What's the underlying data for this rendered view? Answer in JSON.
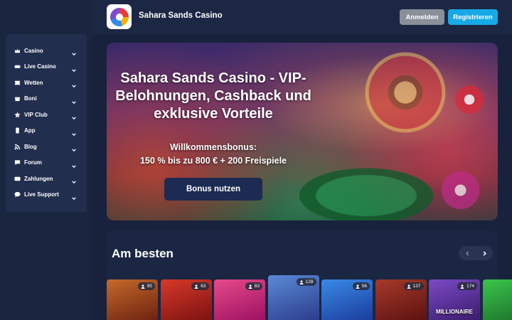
{
  "header": {
    "site_title": "Sahara Sands Casino",
    "login_label": "Anmelden",
    "register_label": "Registrieren"
  },
  "sidebar": {
    "items": [
      {
        "label": "Casino",
        "icon": "crown-icon"
      },
      {
        "label": "Live Casino",
        "icon": "gamepad-icon"
      },
      {
        "label": "Wetten",
        "icon": "ticket-icon"
      },
      {
        "label": "Boni",
        "icon": "gift-icon"
      },
      {
        "label": "VIP Club",
        "icon": "star-icon"
      },
      {
        "label": "App",
        "icon": "smartphone-icon"
      },
      {
        "label": "Blog",
        "icon": "rss-icon"
      },
      {
        "label": "Forum",
        "icon": "chat-icon"
      },
      {
        "label": "Zahlungen",
        "icon": "credit-card-icon"
      },
      {
        "label": "Live Support",
        "icon": "support-chat-icon"
      }
    ]
  },
  "hero": {
    "title": "Sahara Sands Casino - VIP-Belohnungen, Cashback und exklusive Vorteile",
    "bonus_line1": "Willkommensbonus:",
    "bonus_line2": "150 % bis zu 800 € + 200 Freispiele",
    "cta_label": "Bonus nutzen"
  },
  "best_section": {
    "title": "Am besten",
    "games": [
      {
        "players": "95",
        "name": "",
        "colors": [
          "#6a2010",
          "#c46a2a"
        ]
      },
      {
        "players": "63",
        "name": "",
        "colors": [
          "#7a1010",
          "#d63a2a"
        ]
      },
      {
        "players": "83",
        "name": "",
        "colors": [
          "#9a1060",
          "#e64a8a"
        ]
      },
      {
        "players": "128",
        "name": "",
        "colors": [
          "#2a3a8a",
          "#5a8ad6"
        ]
      },
      {
        "players": "56",
        "name": "",
        "colors": [
          "#1a3a9a",
          "#3a8ae6"
        ]
      },
      {
        "players": "137",
        "name": "",
        "colors": [
          "#5a1010",
          "#a63a2a"
        ]
      },
      {
        "players": "174",
        "name": "MILLIONAIRE",
        "colors": [
          "#3a1a6a",
          "#7a4ac6"
        ]
      },
      {
        "players": "",
        "name": "",
        "colors": [
          "#1a6a2a",
          "#3ac64a"
        ]
      }
    ]
  },
  "colors": {
    "accent": "#17a9e6",
    "login_button": "#8a8f99",
    "page_bg": "#1a2540"
  }
}
